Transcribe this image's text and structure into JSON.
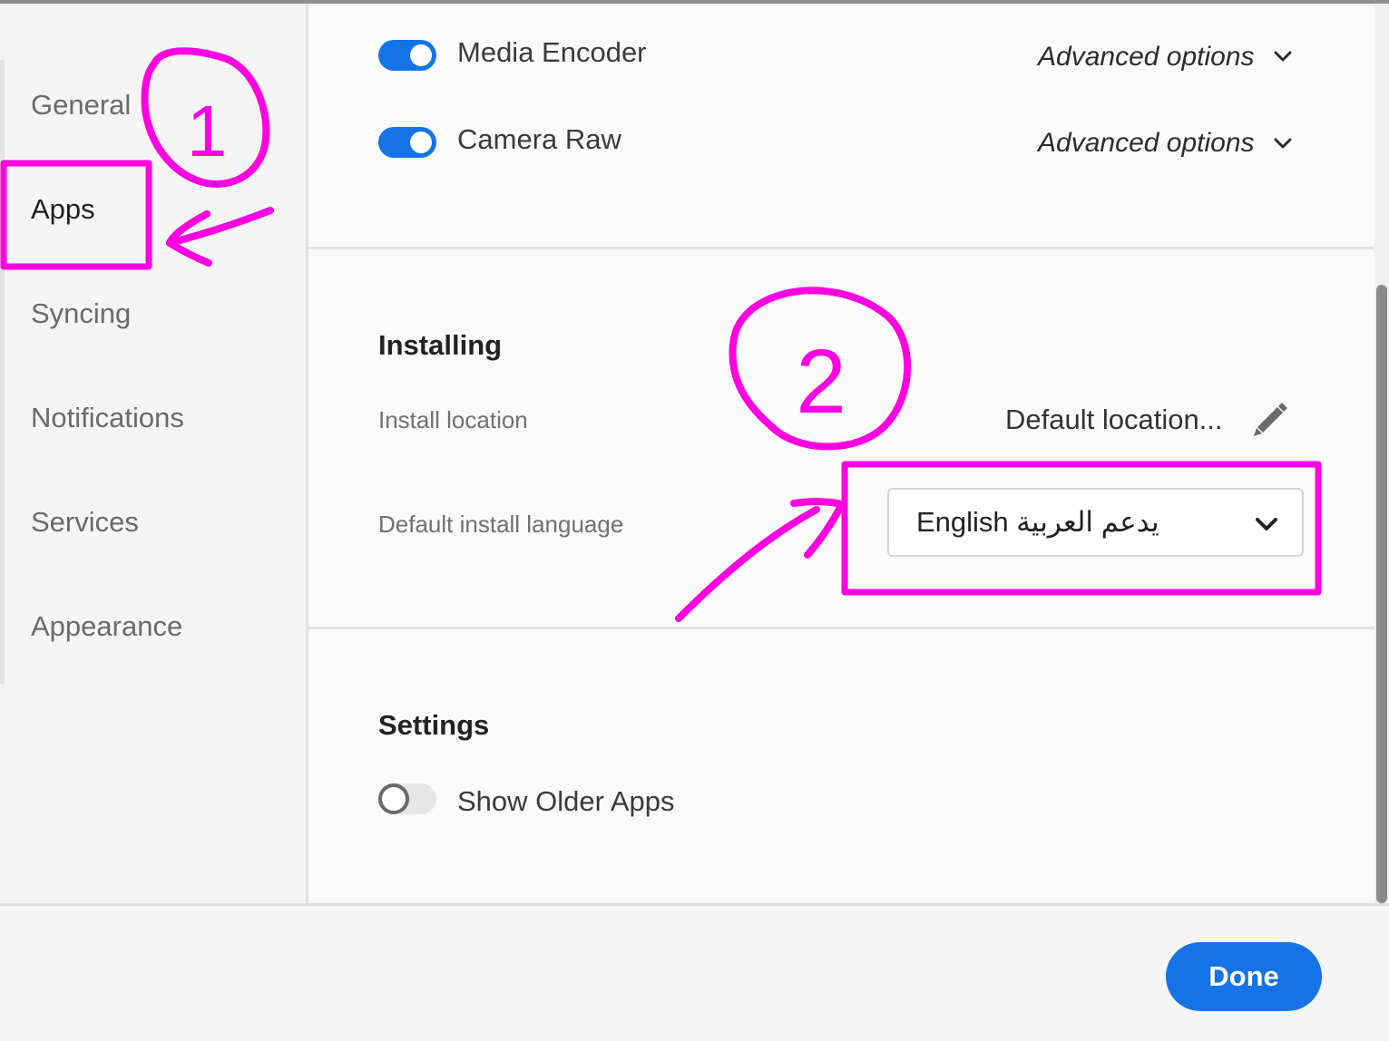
{
  "sidebar": {
    "items": [
      {
        "label": "General"
      },
      {
        "label": "Apps"
      },
      {
        "label": "Syncing"
      },
      {
        "label": "Notifications"
      },
      {
        "label": "Services"
      },
      {
        "label": "Appearance"
      }
    ],
    "active": "Apps"
  },
  "apps": [
    {
      "name": "Media Encoder",
      "enabled": true,
      "advanced_label": "Advanced options"
    },
    {
      "name": "Camera Raw",
      "enabled": true,
      "advanced_label": "Advanced options"
    }
  ],
  "installing": {
    "title": "Installing",
    "install_location_label": "Install location",
    "install_location_value": "Default location...",
    "default_language_label": "Default install language",
    "default_language_value": "English يدعم العربية"
  },
  "settings": {
    "title": "Settings",
    "show_older_apps_label": "Show Older Apps",
    "show_older_apps_enabled": false
  },
  "footer": {
    "done_label": "Done"
  },
  "annotations": {
    "step_1": "1",
    "step_2": "2",
    "color": "#ff00e0"
  },
  "colors": {
    "accent": "#1473e6"
  }
}
